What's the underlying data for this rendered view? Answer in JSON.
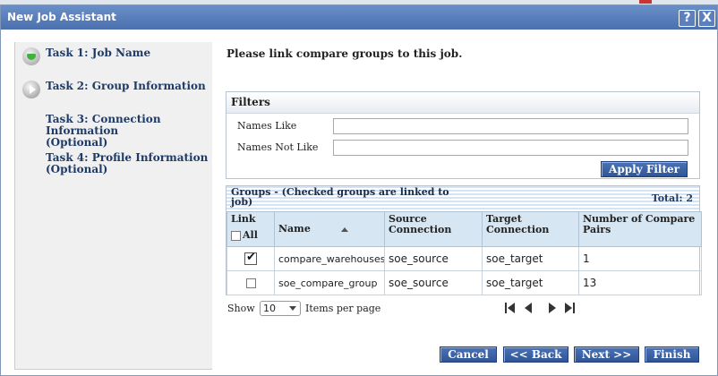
{
  "window": {
    "title": "New Job Assistant",
    "help_label": "?",
    "close_label": "X"
  },
  "tasks": [
    {
      "label": "Task 1: Job Name",
      "status": "done",
      "icon": "check-circle-icon"
    },
    {
      "label": "Task 2: Group Information",
      "status": "current",
      "icon": "play-circle-icon"
    },
    {
      "label": "Task 3: Connection Information (Optional)",
      "status": "pending"
    },
    {
      "label": "Task 4: Profile Information (Optional)",
      "status": "pending"
    }
  ],
  "prompt": "Please link compare groups to this job.",
  "filters": {
    "title": "Filters",
    "names_like_label": "Names Like",
    "names_like_value": "",
    "names_not_like_label": "Names Not Like",
    "names_not_like_value": "",
    "apply_label": "Apply Filter"
  },
  "groups": {
    "title": "Groups - (Checked groups are linked to job)",
    "total": "Total: 2",
    "columns": {
      "link": "Link",
      "all": "All",
      "name": "Name",
      "source": "Source Connection",
      "target": "Target Connection",
      "pairs": "Number of Compare Pairs"
    },
    "rows": [
      {
        "linked": true,
        "name": "compare_warehouses",
        "source": "soe_source",
        "target": "soe_target",
        "pairs": "1"
      },
      {
        "linked": false,
        "name": "soe_compare_group",
        "source": "soe_source",
        "target": "soe_target",
        "pairs": "13"
      }
    ]
  },
  "pager": {
    "show_label": "Show",
    "page_size": "10",
    "per_page_label": "Items per page"
  },
  "buttons": {
    "cancel": "Cancel",
    "back": "<< Back",
    "next": "Next >>",
    "finish": "Finish"
  },
  "colors": {
    "title_bar": "#4a70ae",
    "button": "#2f5597",
    "task_text": "#1e3a66",
    "header_bg": "#d6e6f2"
  }
}
